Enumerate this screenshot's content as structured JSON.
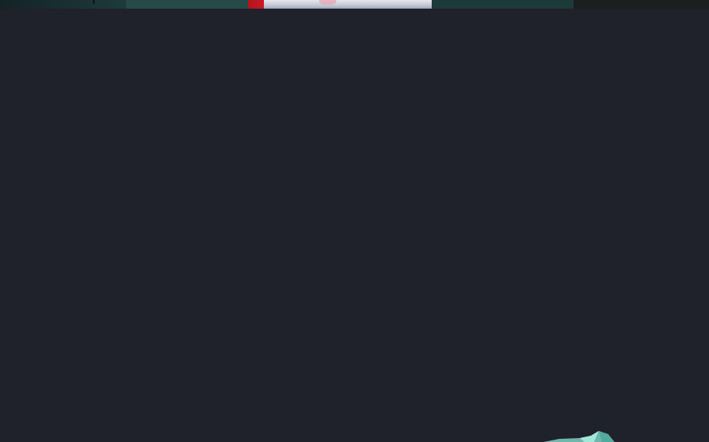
{
  "window": {
    "background_color": "#1f212b"
  },
  "top_strip": {
    "colors": {
      "red_accent": "#c71b2a",
      "light_panel": "#e6e8ee",
      "teal_panel": "#264a47"
    }
  },
  "corner_graphic": {
    "icon": "crystal-shape-icon",
    "color": "#7fd0c4"
  }
}
